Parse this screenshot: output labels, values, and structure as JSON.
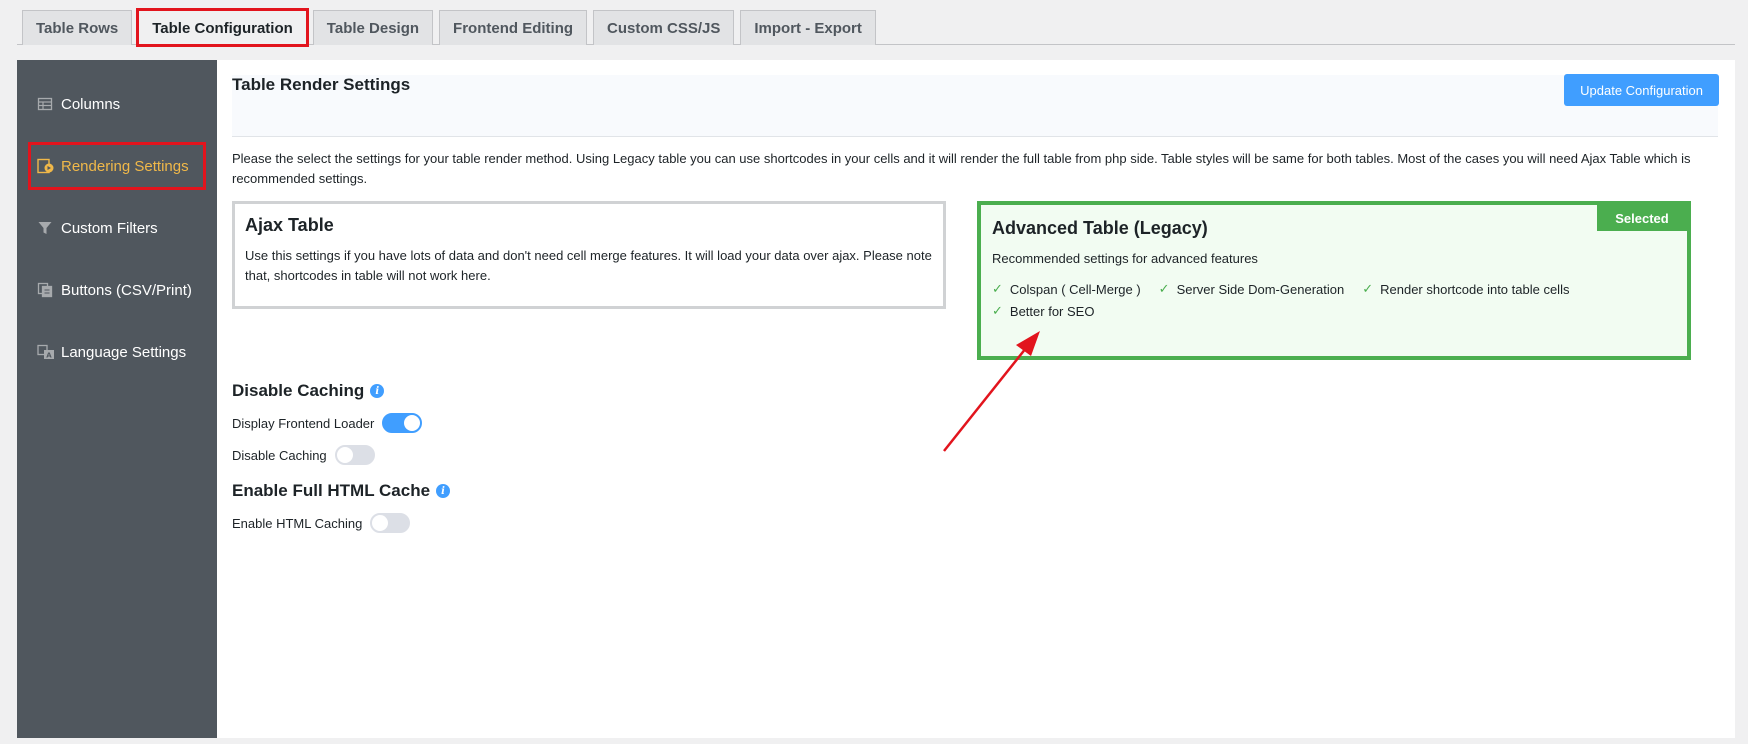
{
  "tabs": [
    {
      "label": "Table Rows"
    },
    {
      "label": "Table Configuration"
    },
    {
      "label": "Table Design"
    },
    {
      "label": "Frontend Editing"
    },
    {
      "label": "Custom CSS/JS"
    },
    {
      "label": "Import - Export"
    }
  ],
  "sidebar": {
    "items": [
      {
        "label": "Columns",
        "icon": "table-icon"
      },
      {
        "label": "Rendering Settings",
        "icon": "render-icon"
      },
      {
        "label": "Custom Filters",
        "icon": "filter-icon"
      },
      {
        "label": "Buttons (CSV/Print)",
        "icon": "copy-icon"
      },
      {
        "label": "Language Settings",
        "icon": "translate-icon"
      }
    ]
  },
  "main": {
    "title": "Table Render Settings",
    "update_button": "Update Configuration",
    "description": "Please the select the settings for your table render method. Using Legacy table you can use shortcodes in your cells and it will render the full table from php side. Table styles will be same for both tables. Most of the cases you will need Ajax Table which is recommended settings.",
    "ajax_card": {
      "title": "Ajax Table",
      "text": "Use this settings if you have lots of data and don't need cell merge features. It will load your data over ajax. Please note that, shortcodes in table will not work here."
    },
    "advanced_card": {
      "title": "Advanced Table (Legacy)",
      "badge": "Selected",
      "text": "Recommended settings for advanced features",
      "features": [
        "Colspan ( Cell-Merge )",
        "Server Side Dom-Generation",
        "Render shortcode into table cells",
        "Better for SEO"
      ]
    },
    "caching": {
      "title": "Disable Caching",
      "frontend_loader_label": "Display Frontend Loader",
      "frontend_loader_on": true,
      "disable_caching_label": "Disable Caching",
      "disable_caching_on": false
    },
    "html_cache": {
      "title": "Enable Full HTML Cache",
      "enable_label": "Enable HTML Caching",
      "enable_on": false
    }
  },
  "colors": {
    "accent": "#409eff",
    "selected_green": "#4bae4f",
    "highlight_red": "#e2141d",
    "sidebar_bg": "#50575e",
    "sidebar_active": "#f0b849"
  }
}
